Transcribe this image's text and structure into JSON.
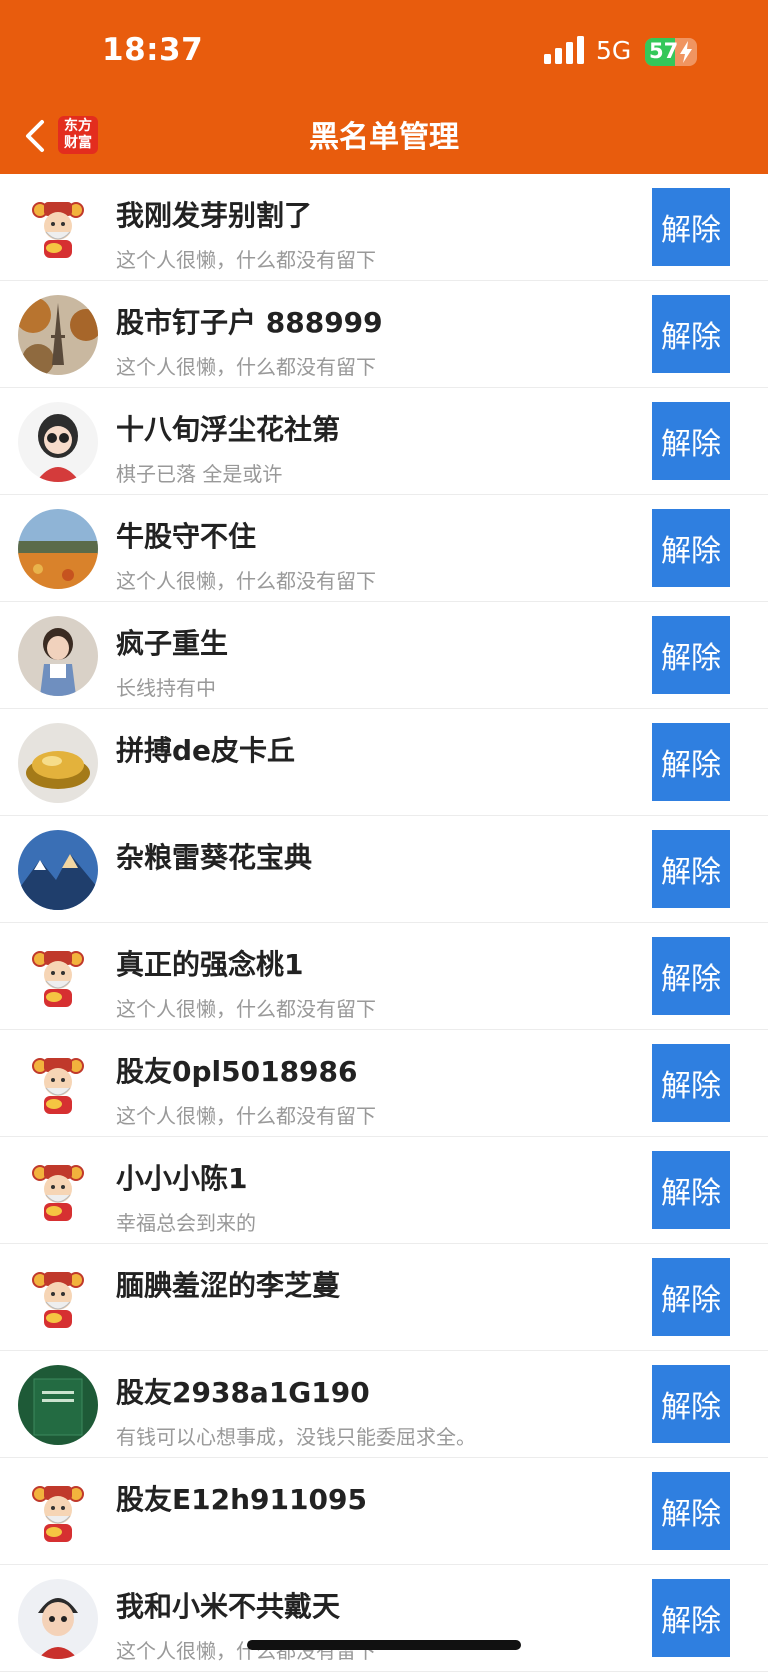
{
  "status_bar": {
    "time": "18:37",
    "network": "5G",
    "battery": "57",
    "battery_level": 0.57
  },
  "header": {
    "title": "黑名单管理",
    "logo_text": "东方财富",
    "logo_line1": "东方",
    "logo_line2": "财富"
  },
  "list": {
    "unblock_label": "解除",
    "items": [
      {
        "name": "我刚发芽别割了",
        "signature": "这个人很懒，什么都没有留下",
        "avatar": "caishen"
      },
      {
        "name": "股市钉子户 888999",
        "signature": "这个人很懒，什么都没有留下",
        "avatar": "eiffel"
      },
      {
        "name": "十八旬浮尘花社第",
        "signature": "棋子已落 全是或许",
        "avatar": "girl"
      },
      {
        "name": "牛股守不住",
        "signature": "这个人很懒，什么都没有留下",
        "avatar": "field"
      },
      {
        "name": "疯子重生",
        "signature": "长线持有中",
        "avatar": "child"
      },
      {
        "name": "拼搏de皮卡丘",
        "signature": "",
        "avatar": "gold"
      },
      {
        "name": "杂粮雷葵花宝典",
        "signature": "",
        "avatar": "mountain"
      },
      {
        "name": "真正的强念桃1",
        "signature": "这个人很懒，什么都没有留下",
        "avatar": "caishen"
      },
      {
        "name": "股友0pl5018986",
        "signature": "这个人很懒，什么都没有留下",
        "avatar": "caishen"
      },
      {
        "name": "小小小陈1",
        "signature": "幸福总会到来的",
        "avatar": "caishen"
      },
      {
        "name": "腼腆羞涩的李芝蔓",
        "signature": "",
        "avatar": "caishen"
      },
      {
        "name": "股友2938a1G190",
        "signature": "有钱可以心想事成，没钱只能委屈求全。",
        "avatar": "book"
      },
      {
        "name": "股友E12h911095",
        "signature": "",
        "avatar": "caishen"
      },
      {
        "name": "我和小米不共戴天",
        "signature": "这个人很懒，什么都没有留下",
        "avatar": "cartoon"
      }
    ]
  }
}
